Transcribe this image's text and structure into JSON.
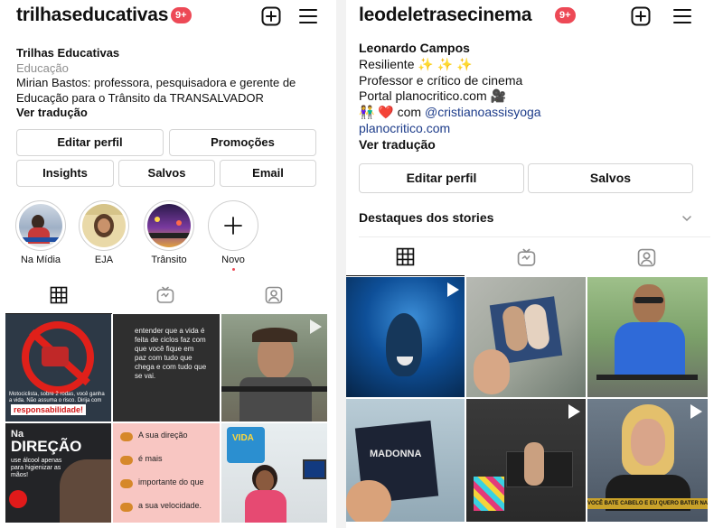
{
  "left": {
    "username": "trilhaseducativas",
    "notif_badge": "9+",
    "bio": {
      "name": "Trilhas Educativas",
      "category": "Educação",
      "line1": "Mirian Bastos: professora, pesquisadora e gerente de",
      "line2": "Educação para o Trânsito da TRANSALVADOR",
      "see_translation": "Ver tradução"
    },
    "buttons": {
      "edit_profile": "Editar perfil",
      "promotions": "Promoções",
      "insights": "Insights",
      "saved": "Salvos",
      "email": "Email"
    },
    "highlights": [
      {
        "label": "Na Mídia"
      },
      {
        "label": "EJA"
      },
      {
        "label": "Trânsito"
      },
      {
        "label": "Novo"
      }
    ],
    "posts": [
      {
        "caption1": "Motociclista, sobre 2 rodas, você ganha a vida. Não assuma o risco. Dirija com",
        "caption2": "responsabilidade!"
      },
      {
        "text": "entender que a vida é feita de ciclos faz com que você fique em paz com tudo que chega e com tudo que se vai."
      },
      {},
      {
        "title1": "Na",
        "title2": "DIREÇÃO",
        "caption": "use álcool apenas para higienizar as mãos!"
      },
      {
        "lines": [
          "A sua direção",
          "é mais",
          "importante do que",
          "a sua velocidade."
        ]
      },
      {
        "sign": "VIDA"
      }
    ]
  },
  "right": {
    "username": "leodeletrasecinema",
    "notif_badge": "9+",
    "bio": {
      "name": "Leonardo Campos",
      "line1": "Resiliente ✨ ✨ ✨",
      "line2": "Professor e crítico de cinema",
      "line3": "Portal planocritico.com 🎥",
      "line4_prefix": "👫 ❤️ com ",
      "line4_mention": "@cristianoassisyoga",
      "link": "planocritico.com",
      "see_translation": "Ver tradução"
    },
    "buttons": {
      "edit_profile": "Editar perfil",
      "saved": "Salvos"
    },
    "highlights_title": "Destaques dos stories",
    "posts": [
      {},
      {},
      {},
      {
        "album_title": "MADONNA"
      },
      {},
      {
        "caption": "VOCÊ BATE CABELO E EU QUERO BATER NA SUA CARA."
      }
    ]
  },
  "colors": {
    "badge": "#ed4956",
    "link": "#1d3c8a",
    "border": "#d5d5d5",
    "muted": "#8e8e8e"
  },
  "icons": [
    "plus-square-icon",
    "hamburger-menu-icon",
    "grid-icon",
    "igtv-icon",
    "tagged-icon",
    "chevron-down-icon",
    "play-icon"
  ]
}
